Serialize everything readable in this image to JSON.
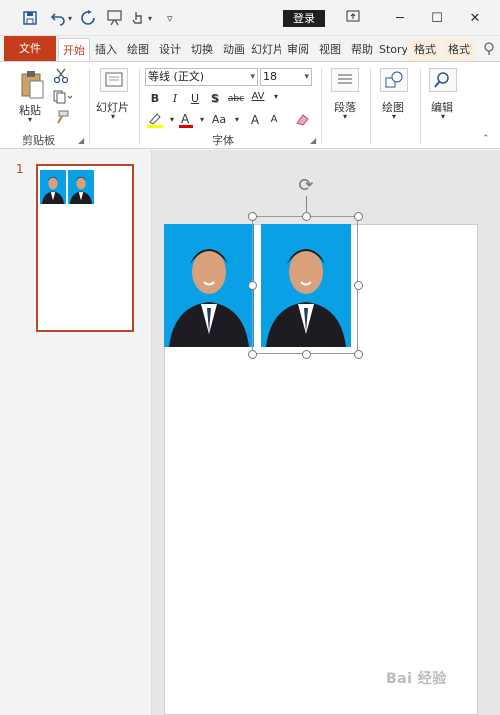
{
  "titlebar": {
    "login_label": "登录"
  },
  "tabs": [
    {
      "label": "文件"
    },
    {
      "label": "开始"
    },
    {
      "label": "插入"
    },
    {
      "label": "绘图"
    },
    {
      "label": "设计"
    },
    {
      "label": "切换"
    },
    {
      "label": "动画"
    },
    {
      "label": "幻灯片"
    },
    {
      "label": "审阅"
    },
    {
      "label": "视图"
    },
    {
      "label": "帮助"
    },
    {
      "label": "Story"
    },
    {
      "label": "格式"
    },
    {
      "label": "格式"
    }
  ],
  "ribbon": {
    "clipboard": {
      "paste_label": "粘贴",
      "group_label": "剪贴板"
    },
    "slides": {
      "new_slide_label": "幻灯片"
    },
    "font": {
      "font_name": "等线 (正文)",
      "font_size": "18",
      "bold": "B",
      "italic": "I",
      "underline": "U",
      "shadow": "S",
      "strike": "abc",
      "spacing": "AV",
      "clear": "Aa",
      "grow": "A",
      "shrink": "A",
      "group_label": "字体"
    },
    "paragraph": {
      "label": "段落"
    },
    "drawing": {
      "label": "绘图"
    },
    "editing": {
      "label": "编辑"
    }
  },
  "slides_pane": {
    "slide_number": "1"
  },
  "watermark": "Bai 经验"
}
